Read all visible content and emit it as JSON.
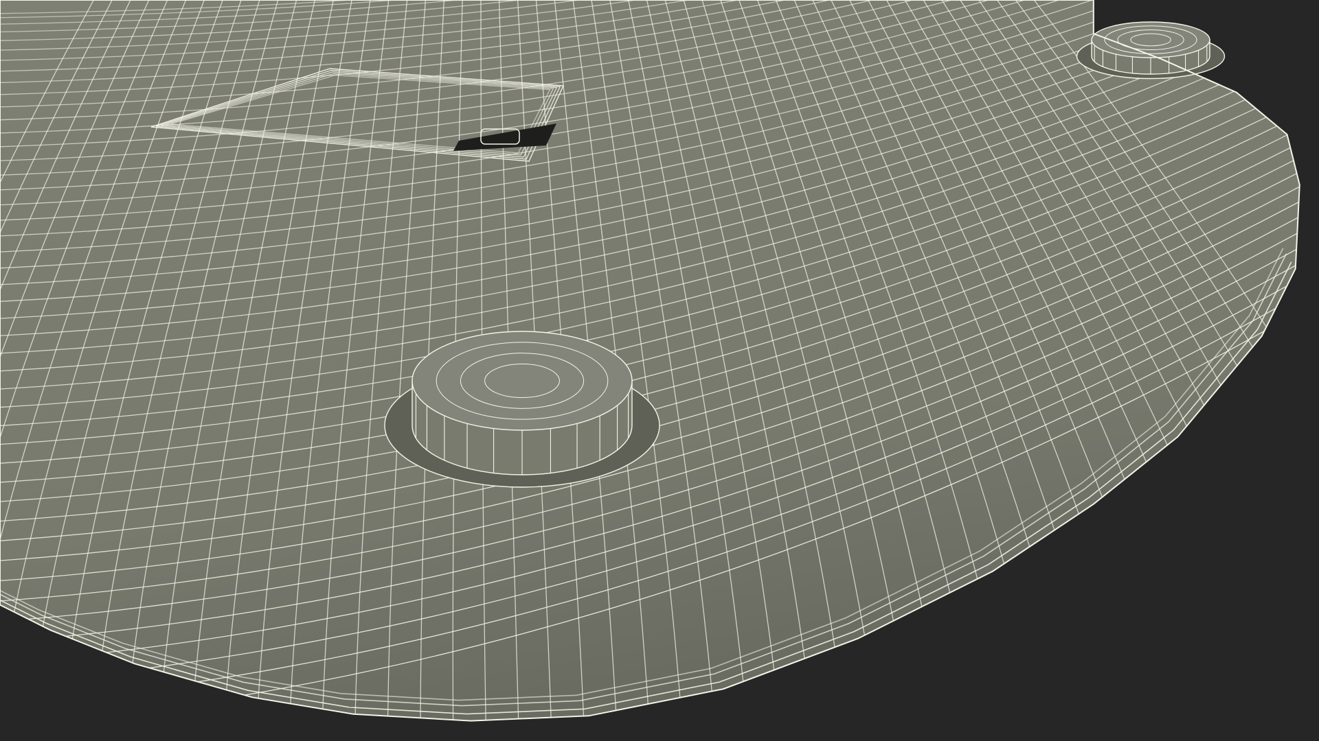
{
  "scene": {
    "background_color": "#262626",
    "surface_color": "#7a7b6f",
    "surface_shadow_color": "#5f6056",
    "wire_color": "#f4f4e8",
    "dark_slot_color": "#1e1f1c"
  }
}
